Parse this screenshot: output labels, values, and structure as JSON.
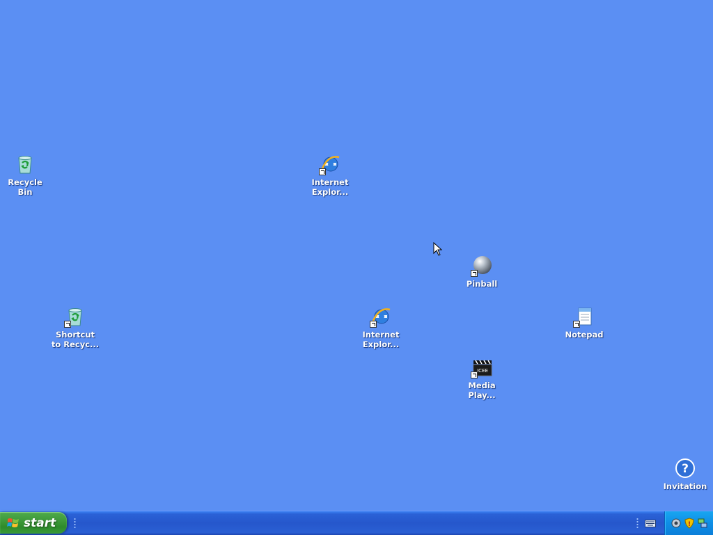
{
  "desktop": {
    "icons": [
      {
        "label_line1": "Recycle",
        "label_line2": "Bin",
        "icon": "recycle-bin-icon"
      },
      {
        "label_line1": "Internet",
        "label_line2": "Explor...",
        "icon": "internet-explorer-icon"
      },
      {
        "label_line1": "Pinball",
        "label_line2": "",
        "icon": "pinball-icon"
      },
      {
        "label_line1": "Shortcut",
        "label_line2": "to Recyc...",
        "icon": "recycle-bin-icon"
      },
      {
        "label_line1": "Internet",
        "label_line2": "Explor...",
        "icon": "internet-explorer-icon"
      },
      {
        "label_line1": "Notepad",
        "label_line2": "",
        "icon": "notepad-icon"
      },
      {
        "label_line1": "Media",
        "label_line2": "Play...",
        "icon": "media-player-icon"
      },
      {
        "label_line1": "Invitation",
        "label_line2": "",
        "icon": "help-icon"
      }
    ],
    "background_color": "#5b8ff3"
  },
  "taskbar": {
    "start_label": "start",
    "tray_icons": [
      "volume-icon",
      "security-shield-icon",
      "network-icon"
    ],
    "keyboard_icon": "keyboard-icon"
  },
  "colors": {
    "start_green": "#3e9a3a",
    "taskbar_blue": "#2657cc",
    "tray_blue": "#0f8ee6"
  }
}
